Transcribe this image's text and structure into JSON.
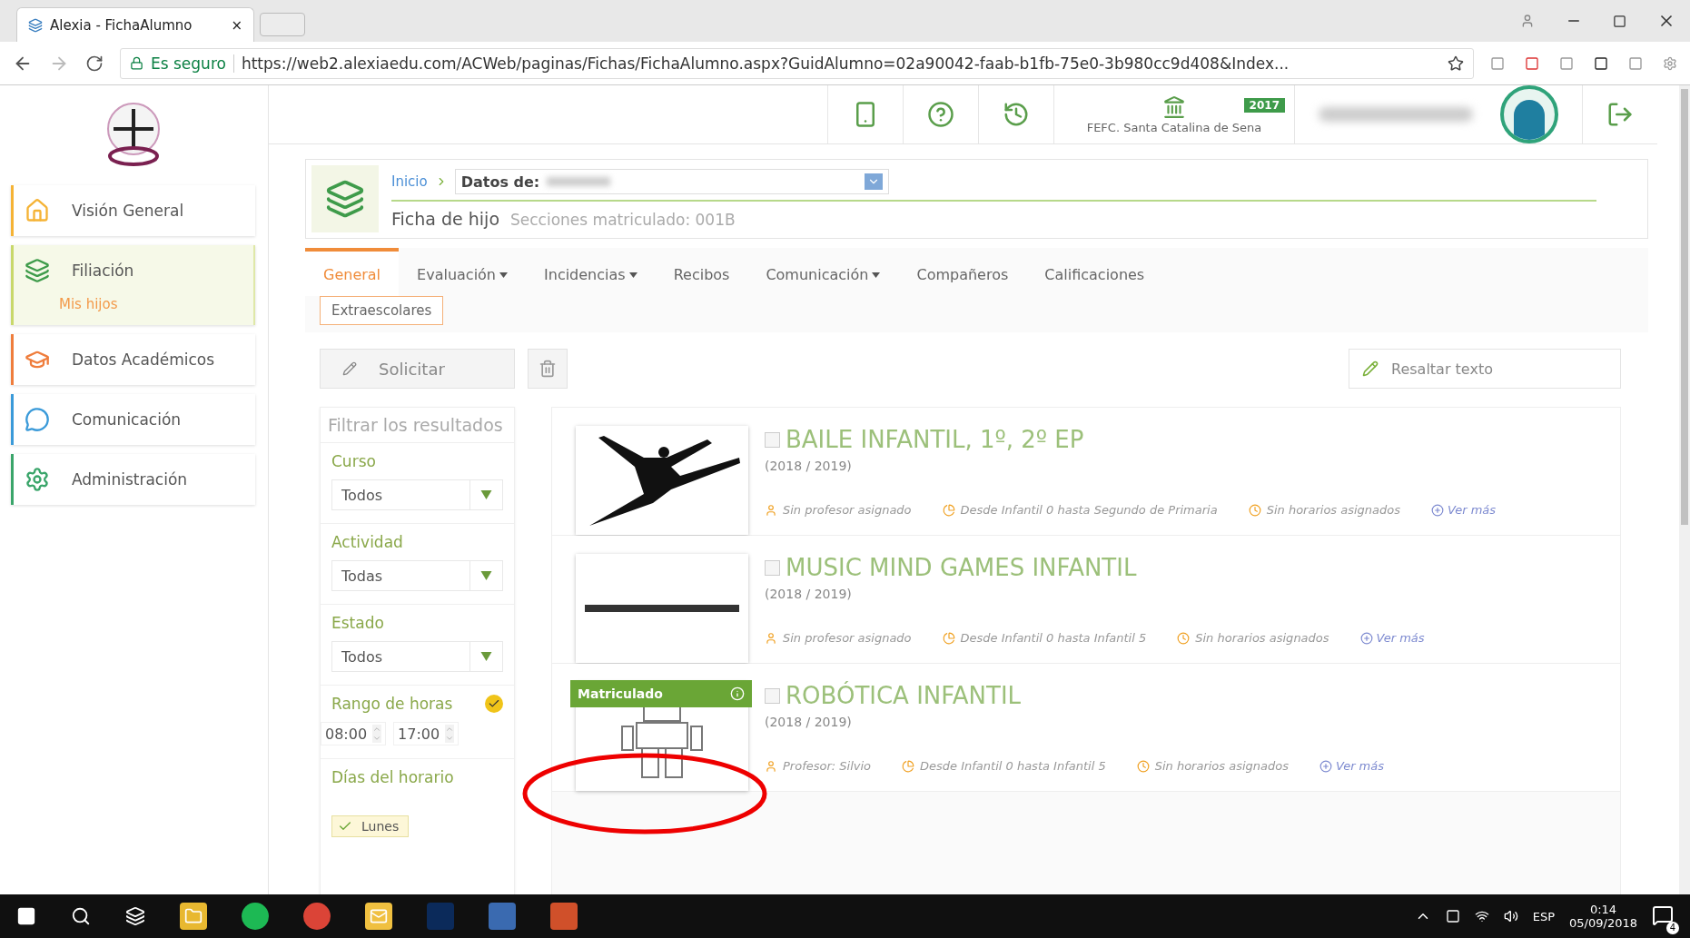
{
  "browser": {
    "tab_title": "Alexia - FichaAlumno",
    "tab_close": "×",
    "secure_label": "Es seguro",
    "url": "https://web2.alexiaedu.com/ACWeb/paginas/Fichas/FichaAlumno.aspx?GuidAlumno=02a90042-faab-b1fb-75e0-3b980cc9d408&Index..."
  },
  "header": {
    "school": "FEFC. Santa Catalina de Sena",
    "year_badge": "2017"
  },
  "sidebar": {
    "items": [
      {
        "label": "Visión General",
        "color": "#f5b335",
        "selected": false
      },
      {
        "label": "Filiación",
        "color": "#c8d86a",
        "selected": true,
        "children": [
          {
            "label": "Mis hijos"
          }
        ]
      },
      {
        "label": "Datos Académicos",
        "color": "#ef7d3c",
        "selected": false
      },
      {
        "label": "Comunicación",
        "color": "#3a9ad9",
        "selected": false
      },
      {
        "label": "Administración",
        "color": "#3aa56a",
        "selected": false
      }
    ]
  },
  "breadcrumb": {
    "home": "Inicio",
    "field_label": "Datos de:"
  },
  "page_title": "Ficha de hijo",
  "page_subtitle": "Secciones matriculado: 001B",
  "tabs": [
    {
      "label": "General",
      "dropdown": false,
      "selected": true
    },
    {
      "label": "Evaluación",
      "dropdown": true,
      "selected": false
    },
    {
      "label": "Incidencias",
      "dropdown": true,
      "selected": false
    },
    {
      "label": "Recibos",
      "dropdown": false,
      "selected": false
    },
    {
      "label": "Comunicación",
      "dropdown": true,
      "selected": false
    },
    {
      "label": "Compañeros",
      "dropdown": false,
      "selected": false
    },
    {
      "label": "Calificaciones",
      "dropdown": false,
      "selected": false
    }
  ],
  "subtabs": [
    {
      "label": "Extraescolares",
      "selected": true
    }
  ],
  "toolbar": {
    "request_button": "Solicitar",
    "highlight_button": "Resaltar texto"
  },
  "filters": {
    "title": "Filtrar los resultados",
    "selects": [
      {
        "label": "Curso",
        "value": "Todos"
      },
      {
        "label": "Actividad",
        "value": "Todas"
      },
      {
        "label": "Estado",
        "value": "Todos"
      }
    ],
    "time_range": {
      "label": "Rango de horas",
      "checked": true,
      "from": "08:00",
      "to": "17:00"
    },
    "days": {
      "label": "Días del horario",
      "items": [
        {
          "label": "Lunes",
          "checked": true
        }
      ]
    }
  },
  "activities": [
    {
      "title": "BAILE INFANTIL, 1º, 2º EP",
      "year": "(2018 / 2019)",
      "checked": false,
      "teacher": "Sin profesor asignado",
      "levels": "Desde Infantil 0 hasta Segundo de Primaria",
      "schedule": "Sin horarios asignados",
      "more": "Ver más"
    },
    {
      "title": "MUSIC MIND GAMES INFANTIL",
      "year": "(2018 / 2019)",
      "checked": false,
      "teacher": "Sin profesor asignado",
      "levels": "Desde Infantil 0 hasta Infantil 5",
      "schedule": "Sin horarios asignados",
      "more": "Ver más"
    },
    {
      "title": "ROBÓTICA INFANTIL",
      "year": "(2018 / 2019)",
      "checked": false,
      "status": "Matriculado",
      "teacher": "Profesor: Silvio",
      "levels": "Desde Infantil 0 hasta Infantil 5",
      "schedule": "Sin horarios asignados",
      "more": "Ver más"
    }
  ],
  "taskbar": {
    "language": "ESP",
    "time": "0:14",
    "date": "05/09/2018",
    "notifications": "4"
  }
}
